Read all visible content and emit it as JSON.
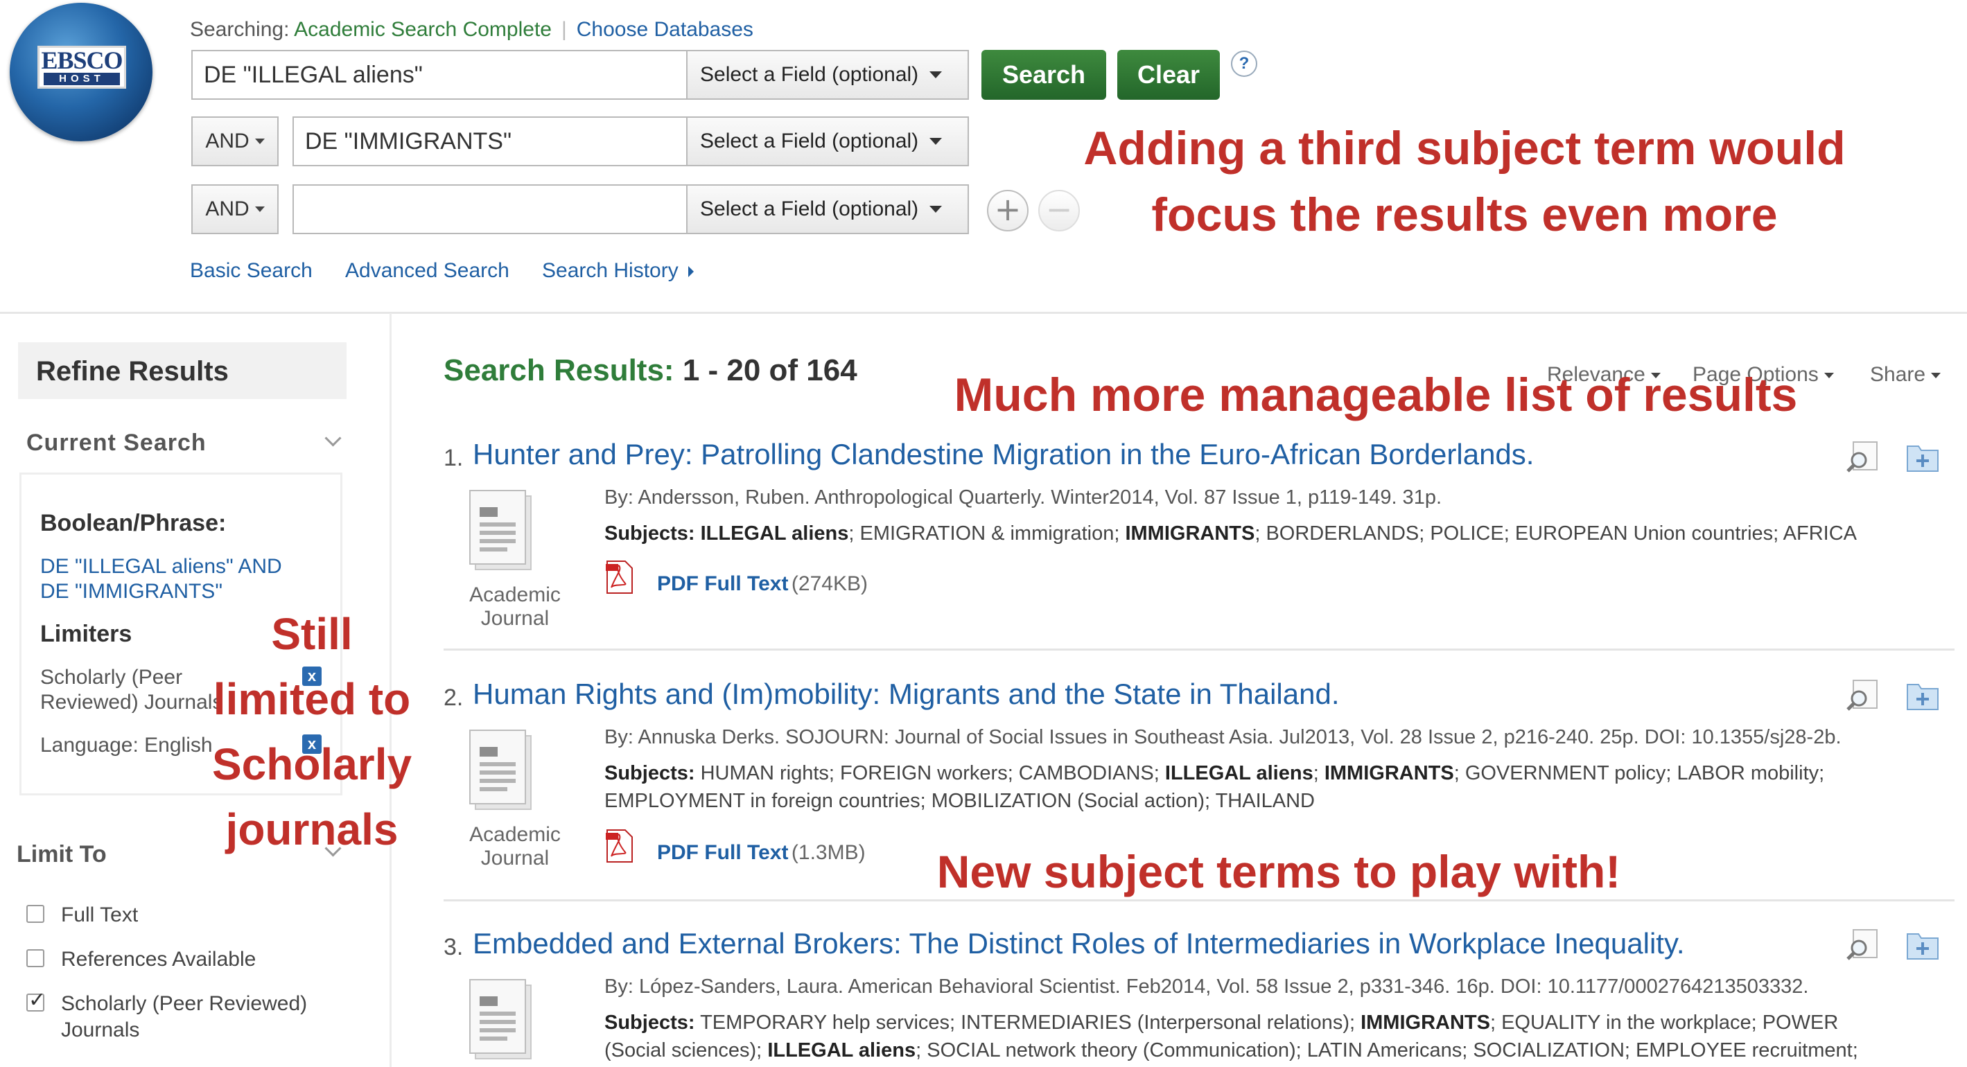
{
  "logo": {
    "line1": "EBSCO",
    "line2": "HOST"
  },
  "header": {
    "searching_label": "Searching:",
    "database": "Academic Search Complete",
    "choose_databases": "Choose Databases",
    "search_button": "Search",
    "clear_button": "Clear",
    "help_label": "?"
  },
  "search_rows": [
    {
      "operator": "",
      "value": "DE \"ILLEGAL aliens\"",
      "field": "Select a Field (optional)"
    },
    {
      "operator": "AND",
      "value": "DE \"IMMIGRANTS\"",
      "field": "Select a Field (optional)"
    },
    {
      "operator": "AND",
      "value": "",
      "field": "Select a Field (optional)"
    }
  ],
  "row_buttons": {
    "add": "+",
    "remove": "−"
  },
  "subnav": {
    "basic": "Basic Search",
    "advanced": "Advanced Search",
    "history": "Search History"
  },
  "sidebar": {
    "refine_title": "Refine Results",
    "current_search": "Current Search",
    "boolean_label": "Boolean/Phrase:",
    "boolean_value_line1": "DE \"ILLEGAL aliens\" AND",
    "boolean_value_line2": "DE \"IMMIGRANTS\"",
    "limiters_label": "Limiters",
    "limiters": [
      {
        "line1": "Scholarly (Peer",
        "line2": "Reviewed) Journals",
        "remove": "x"
      },
      {
        "line1": "Language: English",
        "line2": "",
        "remove": "x"
      }
    ],
    "limit_to_label": "Limit To",
    "limit_to": [
      {
        "label": "Full Text",
        "label2": "",
        "checked": false
      },
      {
        "label": "References Available",
        "label2": "",
        "checked": false
      },
      {
        "label": "Scholarly (Peer Reviewed)",
        "label2": "Journals",
        "checked": true
      }
    ]
  },
  "results": {
    "label": "Search Results:",
    "count": "1 - 20 of 164",
    "sort": {
      "relevance": "Relevance",
      "page_options": "Page Options",
      "share": "Share"
    },
    "items": [
      {
        "num": "1.",
        "title": "Hunter and Prey: Patrolling Clandestine Migration in the Euro-African Borderlands.",
        "meta": "By: Andersson, Ruben. Anthropological Quarterly. Winter2014, Vol. 87 Issue 1, p119-149. 31p.",
        "subjects_label": "Subjects:",
        "subjects": "ILLEGAL aliens; EMIGRATION & immigration; IMMIGRANTS; BORDERLANDS; POLICE; EUROPEAN Union countries; AFRICA",
        "subjects_line2": "",
        "pdf_label": "PDF Full Text",
        "pdf_size": "(274KB)",
        "pubtype_line1": "Academic",
        "pubtype_line2": "Journal"
      },
      {
        "num": "2.",
        "title": "Human Rights and (Im)mobility: Migrants and the State in Thailand.",
        "meta": "By: Annuska Derks. SOJOURN: Journal of Social Issues in Southeast Asia. Jul2013, Vol. 28 Issue 2, p216-240. 25p. DOI: 10.1355/sj28-2b.",
        "subjects_label": "Subjects:",
        "subjects": "HUMAN rights; FOREIGN workers; CAMBODIANS; ILLEGAL aliens; IMMIGRANTS; GOVERNMENT policy; LABOR mobility;",
        "subjects_line2": "EMPLOYMENT in foreign countries; MOBILIZATION (Social action); THAILAND",
        "pdf_label": "PDF Full Text",
        "pdf_size": "(1.3MB)",
        "pubtype_line1": "Academic",
        "pubtype_line2": "Journal"
      },
      {
        "num": "3.",
        "title": "Embedded and External Brokers: The Distinct Roles of Intermediaries in Workplace Inequality.",
        "meta": "By: López-Sanders, Laura. American Behavioral Scientist. Feb2014, Vol. 58 Issue 2, p331-346. 16p. DOI: 10.1177/0002764213503332.",
        "subjects_label": "Subjects:",
        "subjects": "TEMPORARY help services; INTERMEDIARIES (Interpersonal relations); IMMIGRANTS; EQUALITY in the workplace; POWER",
        "subjects_line2": "(Social sciences); ILLEGAL aliens; SOCIAL network theory (Communication); LATIN Americans; SOCIALIZATION; EMPLOYEE recruitment;",
        "pdf_label": "",
        "pdf_size": "",
        "pubtype_line1": "",
        "pubtype_line2": ""
      }
    ]
  },
  "annotations": {
    "third_term_line1": "Adding a third subject term would",
    "third_term_line2": "focus the results even more",
    "manageable": "Much more manageable list of results",
    "scholarly_line1": "Still",
    "scholarly_line2": "limited to",
    "scholarly_line3": "Scholarly",
    "scholarly_line4": "journals",
    "new_terms": "New subject terms to play with!"
  },
  "colors": {
    "annotation": "#c0302a",
    "link": "#1f5fa3",
    "green": "#2f7d3a"
  }
}
